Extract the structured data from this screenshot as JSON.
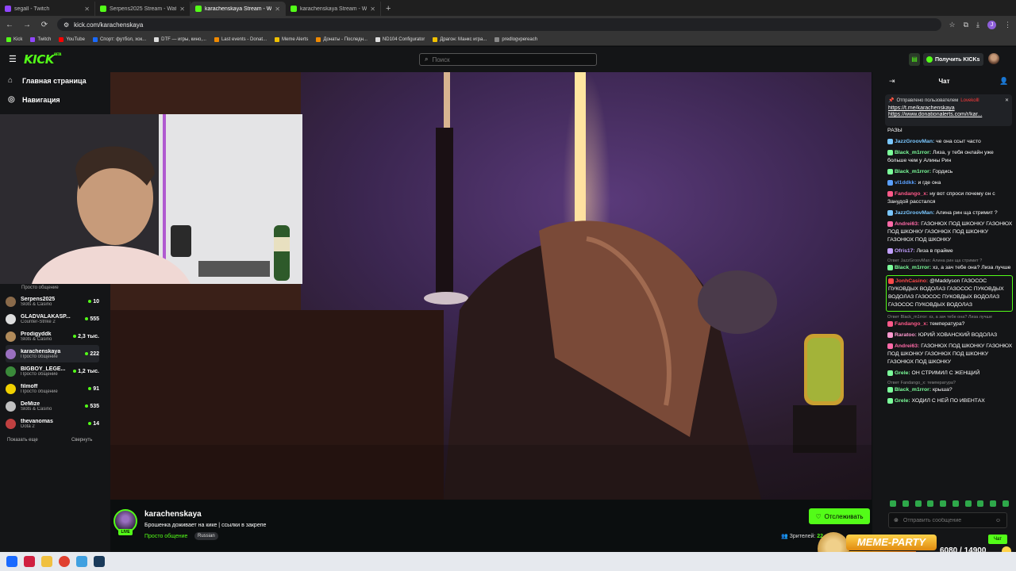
{
  "browser": {
    "tabs": [
      {
        "title": "segall - Twitch",
        "icon": "twitch-favicon",
        "active": false
      },
      {
        "title": "Serpens2025 Stream - Watch Li",
        "icon": "kick-favicon",
        "active": false
      },
      {
        "title": "karachenskaya Stream - Watch",
        "icon": "kick-favicon",
        "active": true
      },
      {
        "title": "karachenskaya Stream - Watch",
        "icon": "kick-favicon",
        "active": false
      }
    ],
    "new_tab": "+",
    "url": "kick.com/karachenskaya",
    "bookmarks": [
      "Kick",
      "Twitch",
      "YouTube",
      "Спорт: футбол, хок...",
      "DTF — игры, кино,...",
      "Last events - Donat...",
      "Meme Alerts",
      "Донаты - Последн...",
      "ND104 Configurator",
      "Драгон: Манкс игра...",
      "predlogvpereach"
    ]
  },
  "header": {
    "logo": "KICK",
    "logo_tag": "BETA",
    "search_placeholder": "Поиск",
    "kicks_label": "Получить KICKs"
  },
  "sidebar": {
    "home": "Главная страница",
    "navigation": "Навигация",
    "first_partial_category": "Просто общение",
    "channels": [
      {
        "name": "Serpens2025",
        "category": "Slots & Casino",
        "viewers": "10",
        "color": "#8a6a4a"
      },
      {
        "name": "GLADVALAKASP...",
        "category": "Counter-Strike 2",
        "viewers": "555",
        "color": "#dddddd"
      },
      {
        "name": "Prodigyddk",
        "category": "Slots & Casino",
        "viewers": "2,3 тыс.",
        "color": "#b08a5a"
      },
      {
        "name": "karachenskaya",
        "category": "Просто общение",
        "viewers": "222",
        "color": "#9a6fc0"
      },
      {
        "name": "BIGBOY_LEGE...",
        "category": "Просто общение",
        "viewers": "1,2 тыс.",
        "color": "#3a8a3a"
      },
      {
        "name": "filmoff",
        "category": "Просто общение",
        "viewers": "91",
        "color": "#f0d000"
      },
      {
        "name": "DeMize",
        "category": "Slots & Casino",
        "viewers": "535",
        "color": "#c0c0c0"
      },
      {
        "name": "thevanomas",
        "category": "Dota 2",
        "viewers": "14",
        "color": "#c04040"
      }
    ],
    "show_more": "Показать еще",
    "collapse": "Свернуть"
  },
  "stream": {
    "name": "karachenskaya",
    "title": "Брошенка доживает на кике | ссылки в закрепе",
    "category": "Просто общение",
    "language": "Russian",
    "live": "LIVE",
    "follow": "Отслеживать",
    "viewers_label": "Зрителей",
    "viewers_value": "22"
  },
  "chat": {
    "title": "Чат",
    "pinned_by": "Отправлено пользователем",
    "pinned_user": "Lovekolll",
    "pinned_links": [
      "https://t.me/karachenskaya",
      "https://www.donationalerts.com/r/kar..."
    ],
    "messages": [
      {
        "reply": "",
        "user": "",
        "text": "РАЗЫ",
        "color": "#ffffff",
        "hl": false
      },
      {
        "reply": "",
        "user": "JazzGroovMan:",
        "text": "че она ссыт часто",
        "color": "#7ac7ff",
        "hl": false
      },
      {
        "reply": "",
        "user": "Black_m1rror:",
        "text": "Лиза, у тебя онлайн уже больше чем у Алины Рин",
        "color": "#7cff9b",
        "hl": false
      },
      {
        "reply": "",
        "user": "Black_m1rror:",
        "text": "Гордись",
        "color": "#7cff9b",
        "hl": false
      },
      {
        "reply": "",
        "user": "vl1ddkk:",
        "text": "и где она",
        "color": "#5aa0ff",
        "hl": false
      },
      {
        "reply": "",
        "user": "Fandango_x:",
        "text": "ну вот спроси почему он с Занудой расстался",
        "color": "#ff5a8a",
        "hl": false
      },
      {
        "reply": "",
        "user": "JazzGroovMan:",
        "text": "Алина рин ща стримит ?",
        "color": "#7ac7ff",
        "hl": false
      },
      {
        "reply": "",
        "user": "Andrei63:",
        "text": "ГАЗОНЮХ ПОД ШКОНКУ ГАЗОНЮХ ПОД ШКОНКУ ГАЗОНЮХ ПОД ШКОНКУ ГАЗОНЮХ ПОД ШКОНКУ",
        "color": "#ff6aa8",
        "hl": false
      },
      {
        "reply": "",
        "user": "Ofris17:",
        "text": "Лиза в прайме",
        "color": "#c2a0ff",
        "hl": false
      },
      {
        "reply": "Ответ JazzGroovMan: Алина рин ща стримит ?",
        "user": "Black_m1rror:",
        "text": "хз, а зач тебе она? Лиза лучше",
        "color": "#7cff9b",
        "hl": false
      },
      {
        "reply": "",
        "user": "JonhCasino:",
        "text": "@Maddyson ГАЗОСОС ПУКОВДЫХ ВОДОЛАЗ ГАЗОСОС ПУКОВДЫХ ВОДОЛАЗ ГАЗОСОС ПУКОВДЫХ ВОДОЛАЗ ГАЗОСОС ПУКОВДЫХ ВОДОЛАЗ",
        "color": "#ff4a4a",
        "hl": true
      },
      {
        "reply": "Ответ Black_m1rror: хз, а зач тебе она? Лиза лучше",
        "user": "Fandango_x:",
        "text": "температура?",
        "color": "#ff5a8a",
        "hl": false
      },
      {
        "reply": "",
        "user": "Raratoo:",
        "text": "ЮРИЙ ХОВАНСКИЙ ВОДОЛАЗ",
        "color": "#ff9ad0",
        "hl": false
      },
      {
        "reply": "",
        "user": "Andrei63:",
        "text": "ГАЗОНЮХ ПОД ШКОНКУ ГАЗОНЮХ ПОД ШКОНКУ ГАЗОНЮХ ПОД ШКОНКУ ГАЗОНЮХ ПОД ШКОНКУ",
        "color": "#ff6aa8",
        "hl": false
      },
      {
        "reply": "",
        "user": "Grele:",
        "text": "ОН СТРИМИЛ С ЖЕНЩИЙ",
        "color": "#7cff9b",
        "hl": false
      },
      {
        "reply": "Ответ Fandango_x: температура?",
        "user": "Black_m1rror:",
        "text": "крыша?",
        "color": "#7cff9b",
        "hl": false
      },
      {
        "reply": "",
        "user": "Grele:",
        "text": "ХОДИЛ С НЕЙ ПО ИВЕНТАХ",
        "color": "#7cff9b",
        "hl": false
      }
    ],
    "input_placeholder": "Отправить сообщение",
    "send": "Чат"
  },
  "overlay": {
    "meme_title": "MEME-PARTY",
    "meme_count": "6080 / 14900",
    "meme_progress": 0.41
  }
}
